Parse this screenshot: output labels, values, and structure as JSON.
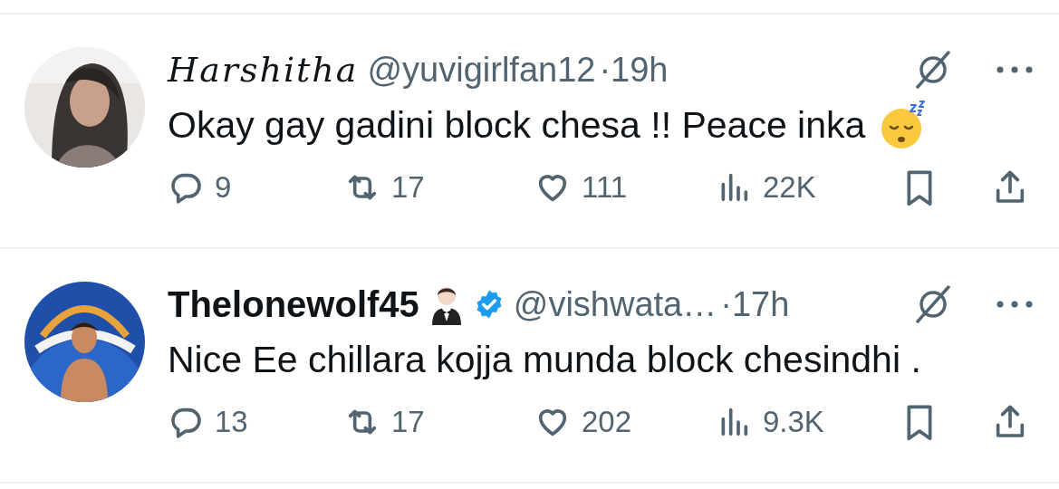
{
  "tweets": [
    {
      "name": "Harshitha",
      "script_name": true,
      "tuxedo_emoji": false,
      "verified": false,
      "handle": "@yuvigirlfan12",
      "time": "·19h",
      "text": "Okay gay gadini block chesa !! Peace inka",
      "sleeping_emoji": true,
      "stats": {
        "replies": "9",
        "reposts": "17",
        "likes": "111",
        "views": "22K"
      }
    },
    {
      "name": "Thelonewolf45",
      "script_name": false,
      "tuxedo_emoji": true,
      "verified": true,
      "handle": "@vishwata…",
      "time": "·17h",
      "text": "Nice Ee chillara kojja munda block chesindhi .",
      "sleeping_emoji": false,
      "stats": {
        "replies": "13",
        "reposts": "17",
        "likes": "202",
        "views": "9.3K"
      }
    }
  ]
}
